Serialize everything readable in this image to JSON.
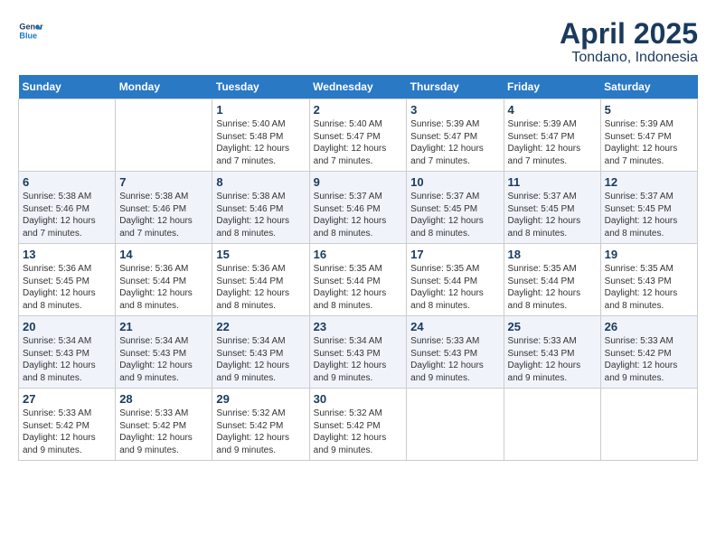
{
  "header": {
    "logo_line1": "General",
    "logo_line2": "Blue",
    "title": "April 2025",
    "subtitle": "Tondano, Indonesia"
  },
  "days_of_week": [
    "Sunday",
    "Monday",
    "Tuesday",
    "Wednesday",
    "Thursday",
    "Friday",
    "Saturday"
  ],
  "weeks": [
    [
      {
        "day": "",
        "content": ""
      },
      {
        "day": "",
        "content": ""
      },
      {
        "day": "1",
        "content": "Sunrise: 5:40 AM\nSunset: 5:48 PM\nDaylight: 12 hours\nand 7 minutes."
      },
      {
        "day": "2",
        "content": "Sunrise: 5:40 AM\nSunset: 5:47 PM\nDaylight: 12 hours\nand 7 minutes."
      },
      {
        "day": "3",
        "content": "Sunrise: 5:39 AM\nSunset: 5:47 PM\nDaylight: 12 hours\nand 7 minutes."
      },
      {
        "day": "4",
        "content": "Sunrise: 5:39 AM\nSunset: 5:47 PM\nDaylight: 12 hours\nand 7 minutes."
      },
      {
        "day": "5",
        "content": "Sunrise: 5:39 AM\nSunset: 5:47 PM\nDaylight: 12 hours\nand 7 minutes."
      }
    ],
    [
      {
        "day": "6",
        "content": "Sunrise: 5:38 AM\nSunset: 5:46 PM\nDaylight: 12 hours\nand 7 minutes."
      },
      {
        "day": "7",
        "content": "Sunrise: 5:38 AM\nSunset: 5:46 PM\nDaylight: 12 hours\nand 7 minutes."
      },
      {
        "day": "8",
        "content": "Sunrise: 5:38 AM\nSunset: 5:46 PM\nDaylight: 12 hours\nand 8 minutes."
      },
      {
        "day": "9",
        "content": "Sunrise: 5:37 AM\nSunset: 5:46 PM\nDaylight: 12 hours\nand 8 minutes."
      },
      {
        "day": "10",
        "content": "Sunrise: 5:37 AM\nSunset: 5:45 PM\nDaylight: 12 hours\nand 8 minutes."
      },
      {
        "day": "11",
        "content": "Sunrise: 5:37 AM\nSunset: 5:45 PM\nDaylight: 12 hours\nand 8 minutes."
      },
      {
        "day": "12",
        "content": "Sunrise: 5:37 AM\nSunset: 5:45 PM\nDaylight: 12 hours\nand 8 minutes."
      }
    ],
    [
      {
        "day": "13",
        "content": "Sunrise: 5:36 AM\nSunset: 5:45 PM\nDaylight: 12 hours\nand 8 minutes."
      },
      {
        "day": "14",
        "content": "Sunrise: 5:36 AM\nSunset: 5:44 PM\nDaylight: 12 hours\nand 8 minutes."
      },
      {
        "day": "15",
        "content": "Sunrise: 5:36 AM\nSunset: 5:44 PM\nDaylight: 12 hours\nand 8 minutes."
      },
      {
        "day": "16",
        "content": "Sunrise: 5:35 AM\nSunset: 5:44 PM\nDaylight: 12 hours\nand 8 minutes."
      },
      {
        "day": "17",
        "content": "Sunrise: 5:35 AM\nSunset: 5:44 PM\nDaylight: 12 hours\nand 8 minutes."
      },
      {
        "day": "18",
        "content": "Sunrise: 5:35 AM\nSunset: 5:44 PM\nDaylight: 12 hours\nand 8 minutes."
      },
      {
        "day": "19",
        "content": "Sunrise: 5:35 AM\nSunset: 5:43 PM\nDaylight: 12 hours\nand 8 minutes."
      }
    ],
    [
      {
        "day": "20",
        "content": "Sunrise: 5:34 AM\nSunset: 5:43 PM\nDaylight: 12 hours\nand 8 minutes."
      },
      {
        "day": "21",
        "content": "Sunrise: 5:34 AM\nSunset: 5:43 PM\nDaylight: 12 hours\nand 9 minutes."
      },
      {
        "day": "22",
        "content": "Sunrise: 5:34 AM\nSunset: 5:43 PM\nDaylight: 12 hours\nand 9 minutes."
      },
      {
        "day": "23",
        "content": "Sunrise: 5:34 AM\nSunset: 5:43 PM\nDaylight: 12 hours\nand 9 minutes."
      },
      {
        "day": "24",
        "content": "Sunrise: 5:33 AM\nSunset: 5:43 PM\nDaylight: 12 hours\nand 9 minutes."
      },
      {
        "day": "25",
        "content": "Sunrise: 5:33 AM\nSunset: 5:43 PM\nDaylight: 12 hours\nand 9 minutes."
      },
      {
        "day": "26",
        "content": "Sunrise: 5:33 AM\nSunset: 5:42 PM\nDaylight: 12 hours\nand 9 minutes."
      }
    ],
    [
      {
        "day": "27",
        "content": "Sunrise: 5:33 AM\nSunset: 5:42 PM\nDaylight: 12 hours\nand 9 minutes."
      },
      {
        "day": "28",
        "content": "Sunrise: 5:33 AM\nSunset: 5:42 PM\nDaylight: 12 hours\nand 9 minutes."
      },
      {
        "day": "29",
        "content": "Sunrise: 5:32 AM\nSunset: 5:42 PM\nDaylight: 12 hours\nand 9 minutes."
      },
      {
        "day": "30",
        "content": "Sunrise: 5:32 AM\nSunset: 5:42 PM\nDaylight: 12 hours\nand 9 minutes."
      },
      {
        "day": "",
        "content": ""
      },
      {
        "day": "",
        "content": ""
      },
      {
        "day": "",
        "content": ""
      }
    ]
  ]
}
